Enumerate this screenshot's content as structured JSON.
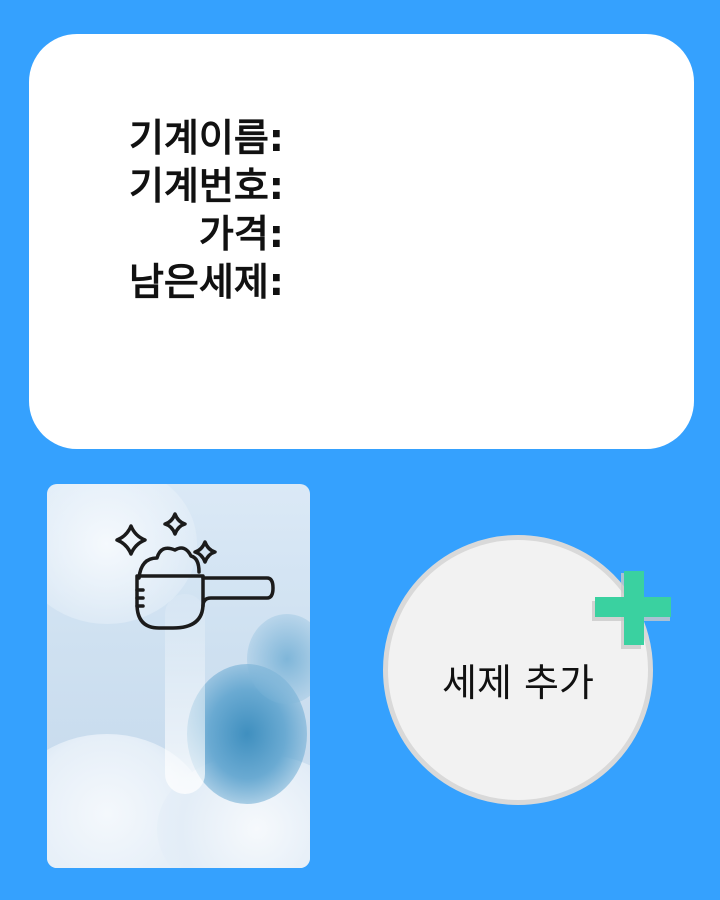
{
  "info_card": {
    "rows": [
      {
        "label": "기계이름:"
      },
      {
        "label": "기계번호:"
      },
      {
        "label": "가격:"
      },
      {
        "label": "남은세제:"
      }
    ]
  },
  "photo": {
    "icon": "detergent-scoop-icon"
  },
  "add_detergent": {
    "label": "세제 추가",
    "icon": "plus-icon",
    "accent_color": "#3ad1a0"
  },
  "colors": {
    "background": "#35a1fe",
    "card": "#ffffff",
    "button": "#f2f2f2"
  }
}
